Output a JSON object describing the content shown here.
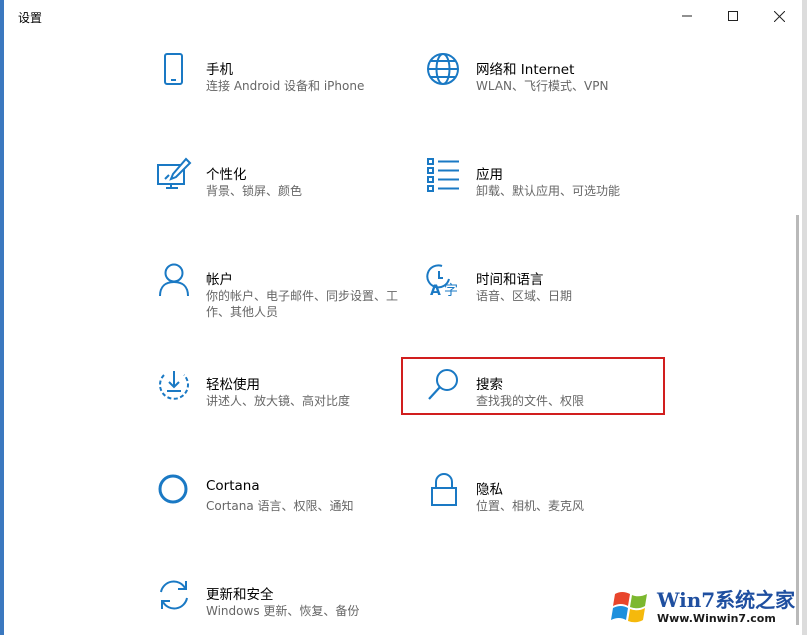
{
  "window": {
    "title": "设置",
    "controls": {
      "minimize": "minimize",
      "maximize": "maximize",
      "close": "close"
    }
  },
  "categories": [
    {
      "label": "手机",
      "desc": "连接 Android 设备和 iPhone",
      "icon": "phone-icon"
    },
    {
      "label": "网络和 Internet",
      "desc": "WLAN、飞行模式、VPN",
      "icon": "globe-icon"
    },
    {
      "label": "个性化",
      "desc": "背景、锁屏、颜色",
      "icon": "personalization-icon"
    },
    {
      "label": "应用",
      "desc": "卸载、默认应用、可选功能",
      "icon": "apps-list-icon"
    },
    {
      "label": "帐户",
      "desc": "你的帐户、电子邮件、同步设置、工作、其他人员",
      "icon": "account-icon"
    },
    {
      "label": "时间和语言",
      "desc": "语音、区域、日期",
      "icon": "time-language-icon"
    },
    {
      "label": "轻松使用",
      "desc": "讲述人、放大镜、高对比度",
      "icon": "ease-of-access-icon"
    },
    {
      "label": "搜索",
      "desc": "查找我的文件、权限",
      "icon": "search-icon"
    },
    {
      "label": "Cortana",
      "desc": "Cortana 语言、权限、通知",
      "icon": "cortana-icon"
    },
    {
      "label": "隐私",
      "desc": "位置、相机、麦克风",
      "icon": "lock-icon"
    },
    {
      "label": "更新和安全",
      "desc": "Windows 更新、恢复、备份",
      "icon": "update-icon"
    }
  ],
  "watermark": {
    "text": "Win7系统之家",
    "url": "Www.Winwin7.com"
  },
  "colors": {
    "accent": "#1a79c4",
    "highlight": "#d11e1e",
    "label": "#000000",
    "desc": "#666666"
  }
}
